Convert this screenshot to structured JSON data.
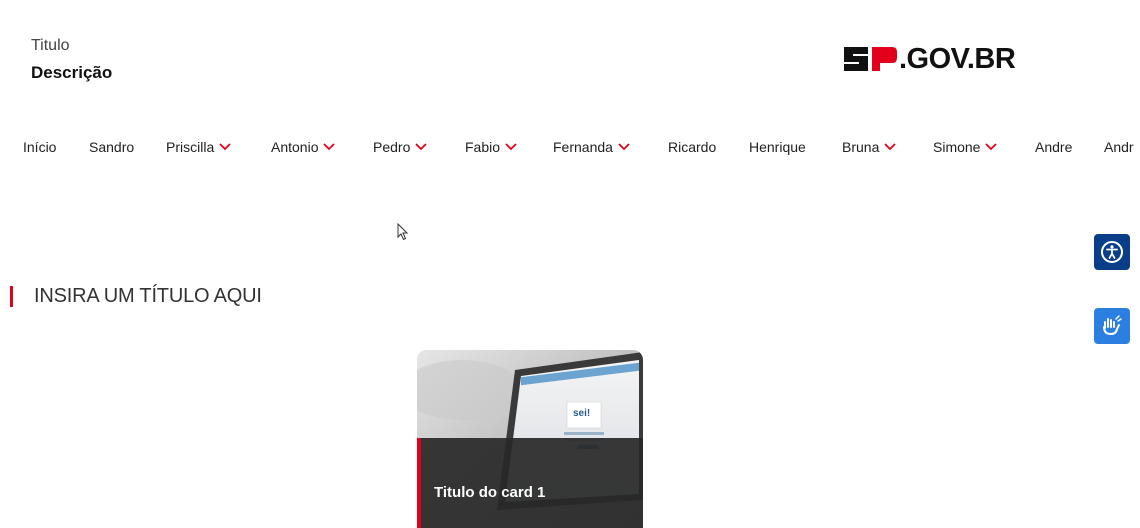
{
  "header": {
    "title": "Titulo",
    "description": "Descrição",
    "logo_text": ".GOV.BR"
  },
  "nav": {
    "items": [
      {
        "label": "Início",
        "has_dropdown": false
      },
      {
        "label": "Sandro",
        "has_dropdown": false
      },
      {
        "label": "Priscilla",
        "has_dropdown": true
      },
      {
        "label": "Antonio",
        "has_dropdown": true
      },
      {
        "label": "Pedro",
        "has_dropdown": true
      },
      {
        "label": "Fabio",
        "has_dropdown": true
      },
      {
        "label": "Fernanda",
        "has_dropdown": true
      },
      {
        "label": "Ricardo",
        "has_dropdown": false
      },
      {
        "label": "Henrique",
        "has_dropdown": false
      },
      {
        "label": "Bruna",
        "has_dropdown": true
      },
      {
        "label": "Simone",
        "has_dropdown": true
      },
      {
        "label": "Andre",
        "has_dropdown": false
      },
      {
        "label": "Andr",
        "has_dropdown": false
      }
    ]
  },
  "accessibility": {
    "buttons": [
      {
        "icon": "accessibility-icon",
        "color": "#0a3e86"
      },
      {
        "icon": "sign-language-icon",
        "color": "#2a7fe0"
      }
    ]
  },
  "section": {
    "title": "INSIRA UM TÍTULO AQUI"
  },
  "cards": [
    {
      "title": "Titulo do card 1",
      "image_text": "sei!"
    }
  ],
  "colors": {
    "accent": "#e2001a",
    "text": "#222222"
  }
}
